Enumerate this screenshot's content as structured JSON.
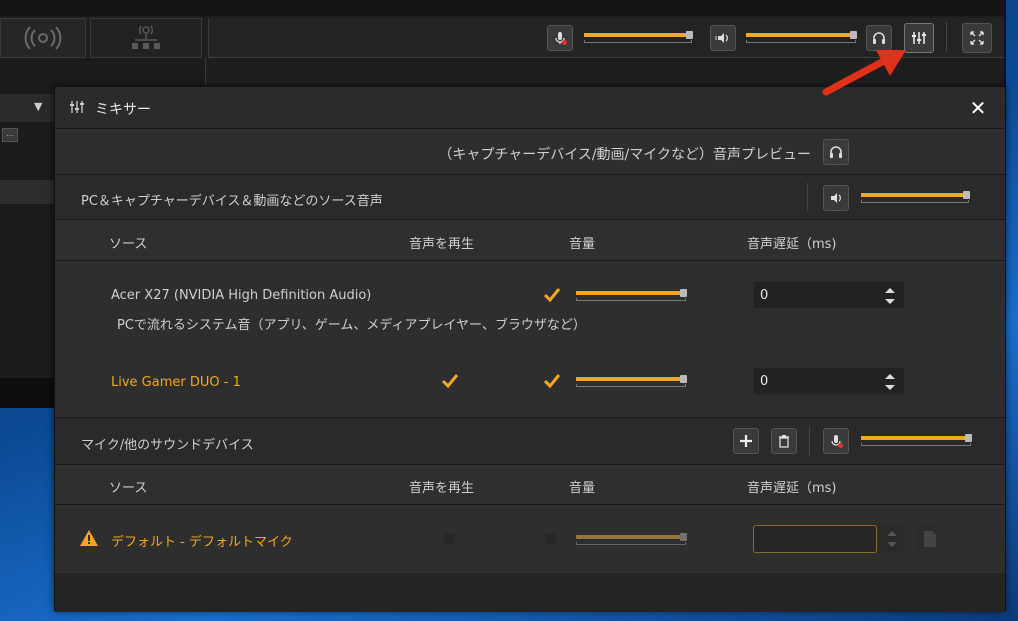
{
  "mixer": {
    "title": "ミキサー",
    "preview_label": "（キャプチャーデバイス/動画/マイクなど）音声プレビュー",
    "pc_section": {
      "label": "PC＆キャプチャーデバイス＆動画などのソース音声",
      "volume": 0.95
    },
    "pc_table": {
      "columns": [
        "ソース",
        "音声を再生",
        "音量",
        "音声遅延（ms)"
      ],
      "rows": [
        {
          "name": "Acer X27 (NVIDIA High Definition Audio)",
          "subtitle": "PCで流れるシステム音（アプリ、ゲーム、メディアプレイヤー、ブラウザなど）",
          "play": false,
          "volume_checked": true,
          "volume": 0.95,
          "delay": "0"
        },
        {
          "name": "Live Gamer DUO - 1",
          "subtitle": "",
          "play": true,
          "volume_checked": true,
          "volume": 0.95,
          "delay": "0"
        }
      ]
    },
    "mic_section": {
      "label": "マイク/他のサウンドデバイス",
      "volume": 0.95
    },
    "mic_table": {
      "columns": [
        "ソース",
        "音声を再生",
        "音量",
        "音声遅延（ms)"
      ],
      "rows": [
        {
          "name": "デフォルト - デフォルトマイク",
          "warning": true,
          "play": false,
          "volume_checked": false,
          "volume": 0.95,
          "delay": ""
        }
      ]
    }
  },
  "toolbar": {
    "mic_volume": 0.95,
    "speaker_volume": 0.95
  },
  "colors": {
    "accent": "#f5a623",
    "panel_bg": "#2e2e2e",
    "arrow": "#e0311b"
  },
  "icons": [
    "mic-icon",
    "speaker-icon",
    "headphones-icon",
    "mixer-icon",
    "fullscreen-icon",
    "close-icon",
    "plus-icon",
    "trash-icon",
    "warning-icon",
    "checkmark-icon",
    "broadcast-icon",
    "network-icon"
  ]
}
